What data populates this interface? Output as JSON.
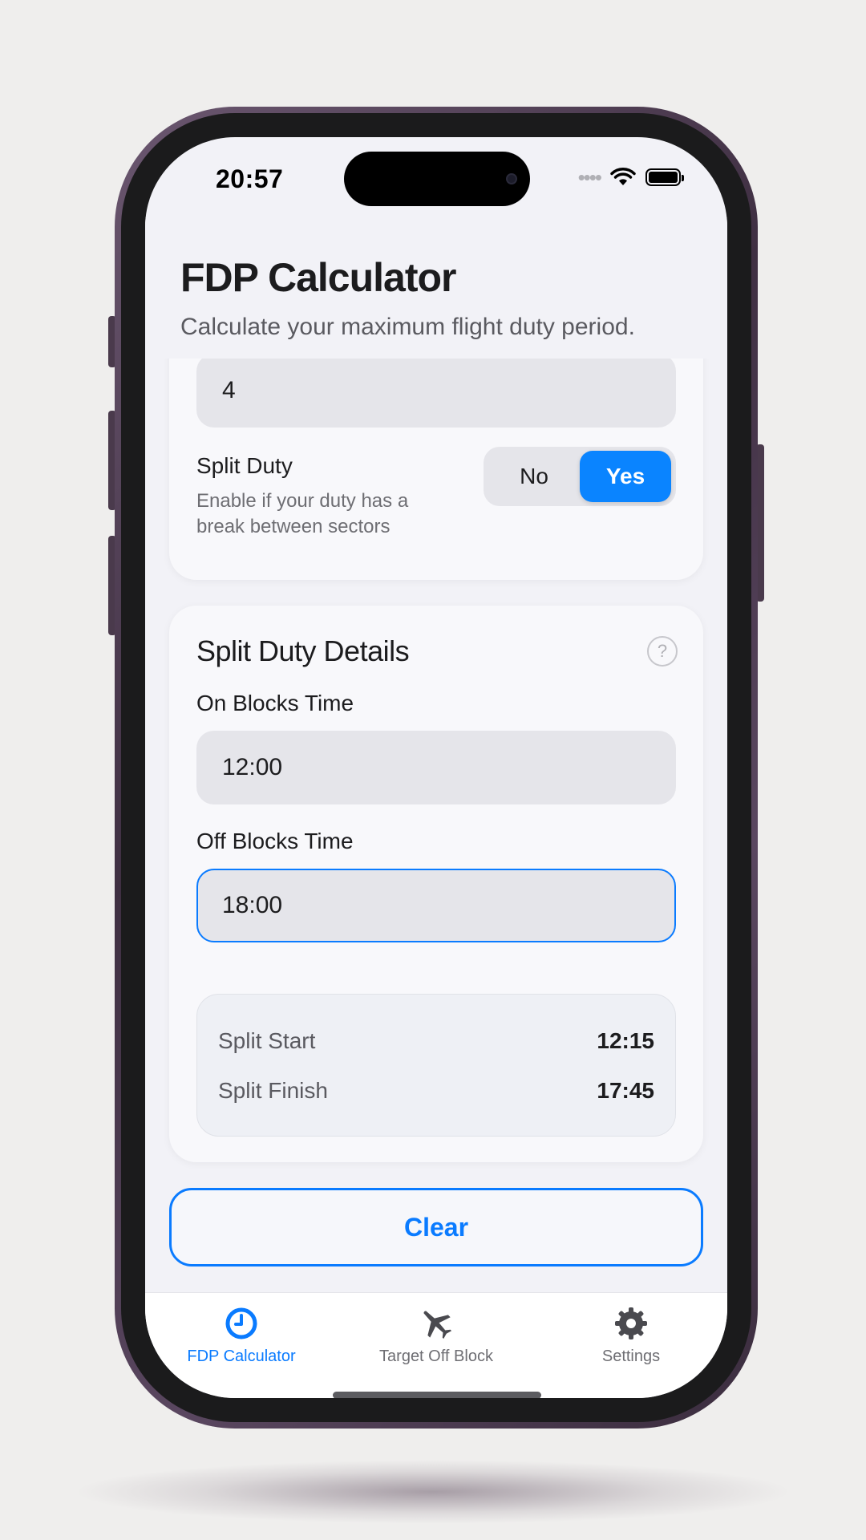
{
  "status_bar": {
    "time": "20:57"
  },
  "header": {
    "title": "FDP Calculator",
    "subtitle": "Calculate your maximum flight duty period."
  },
  "sectors_field": {
    "value": "4"
  },
  "split_duty": {
    "label": "Split Duty",
    "description": "Enable if your duty has a break between sectors",
    "options": [
      "No",
      "Yes"
    ],
    "selected": "Yes"
  },
  "split_details": {
    "title": "Split Duty Details",
    "help_glyph": "?",
    "on_blocks_label": "On Blocks Time",
    "on_blocks_value": "12:00",
    "off_blocks_label": "Off Blocks Time",
    "off_blocks_value": "18:00",
    "summary": [
      {
        "label": "Split Start",
        "value": "12:15"
      },
      {
        "label": "Split Finish",
        "value": "17:45"
      }
    ]
  },
  "clear_button": {
    "label": "Clear"
  },
  "tabbar": {
    "items": [
      {
        "label": "FDP Calculator",
        "icon": "clock-icon",
        "active": true
      },
      {
        "label": "Target Off Block",
        "icon": "airplane-icon",
        "active": false
      },
      {
        "label": "Settings",
        "icon": "gear-icon",
        "active": false
      }
    ]
  },
  "colors": {
    "accent": "#0a84ff",
    "background": "#f2f2f7",
    "card": "#f8f8fb"
  }
}
